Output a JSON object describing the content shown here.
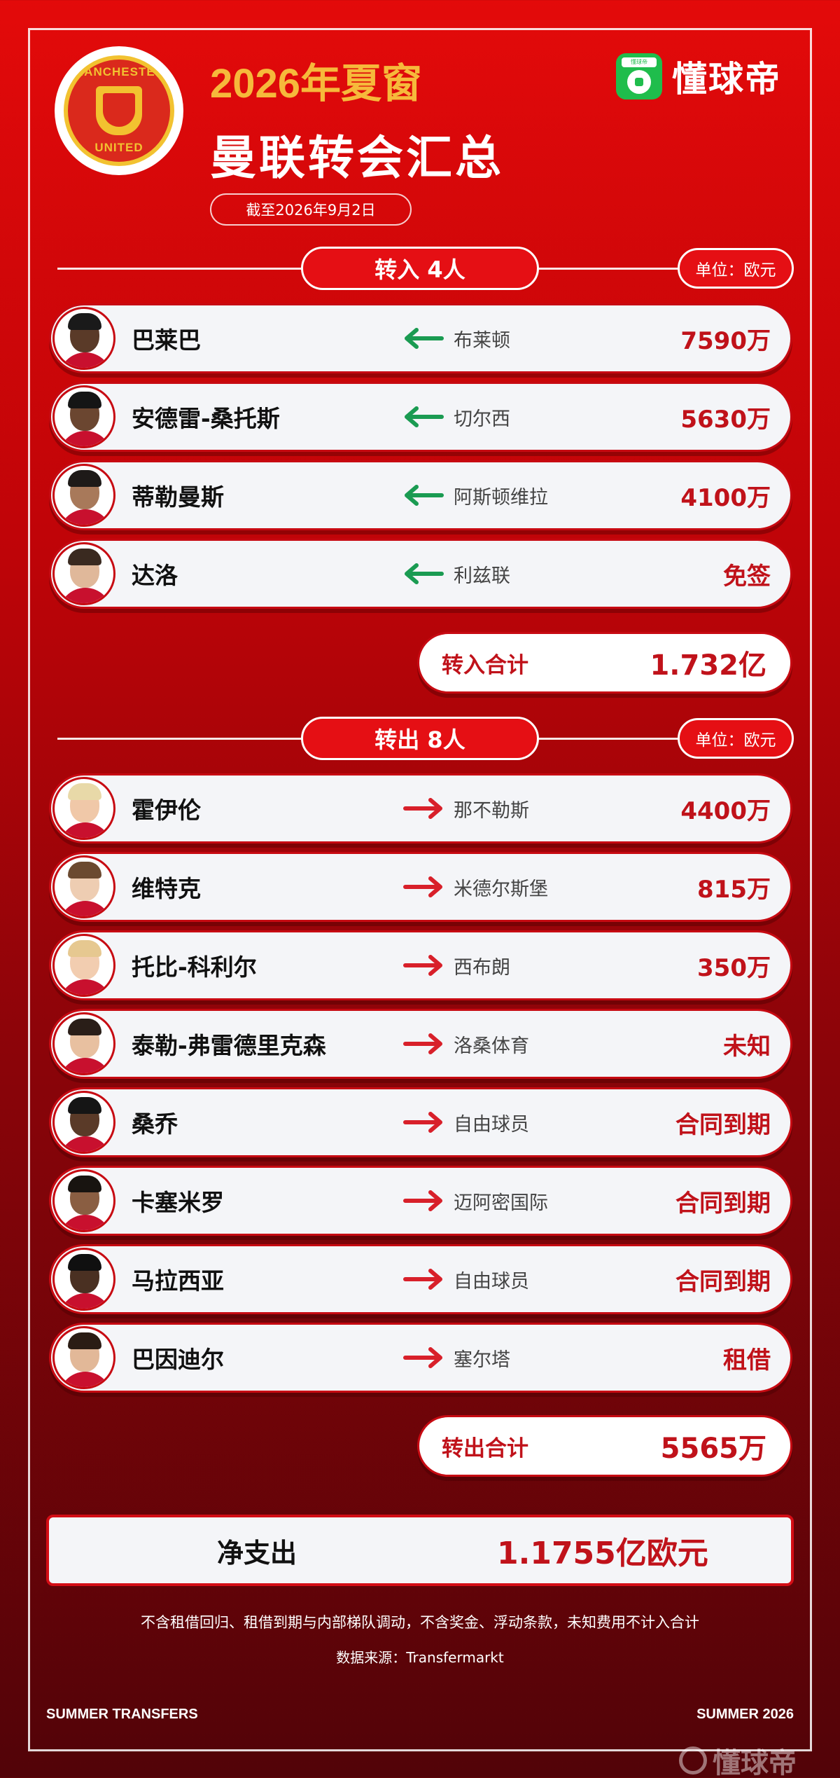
{
  "header": {
    "year_title": "2026年夏窗",
    "main_title": "曼联转会汇总",
    "date": "截至2026年9月2日",
    "brand_name": "懂球帝",
    "brand_icon_tag": "懂球帝",
    "crest_top": "MANCHESTER",
    "crest_bottom": "UNITED"
  },
  "incoming": {
    "title": "转入 4人",
    "unit": "单位：欧元",
    "players": [
      {
        "name": "巴莱巴",
        "club": "布莱顿",
        "fee": "7590万",
        "skin": "#5a3a28",
        "hair": "#1a1a1a"
      },
      {
        "name": "安德雷-桑托斯",
        "club": "切尔西",
        "fee": "5630万",
        "skin": "#6b4630",
        "hair": "#151515"
      },
      {
        "name": "蒂勒曼斯",
        "club": "阿斯顿维拉",
        "fee": "4100万",
        "skin": "#a8795a",
        "hair": "#1e1a18"
      },
      {
        "name": "达洛",
        "club": "利兹联",
        "fee": "免签",
        "skin": "#e0b89a",
        "hair": "#3a2a20"
      }
    ],
    "total_label": "转入合计",
    "total_value": "1.732亿"
  },
  "outgoing": {
    "title": "转出 8人",
    "unit": "单位：欧元",
    "players": [
      {
        "name": "霍伊伦",
        "club": "那不勒斯",
        "fee": "4400万",
        "skin": "#f0c8a8",
        "hair": "#e8d9a8"
      },
      {
        "name": "维特克",
        "club": "米德尔斯堡",
        "fee": "815万",
        "skin": "#eecdb2",
        "hair": "#6b4a30"
      },
      {
        "name": "托比-科利尔",
        "club": "西布朗",
        "fee": "350万",
        "skin": "#f2cdb0",
        "hair": "#e6c890"
      },
      {
        "name": "泰勒-弗雷德里克森",
        "club": "洛桑体育",
        "fee": "未知",
        "skin": "#e8c0a0",
        "hair": "#2a1e18"
      },
      {
        "name": "桑乔",
        "club": "自由球员",
        "fee": "合同到期",
        "skin": "#5a3a28",
        "hair": "#151515"
      },
      {
        "name": "卡塞米罗",
        "club": "迈阿密国际",
        "fee": "合同到期",
        "skin": "#8a5e42",
        "hair": "#181410"
      },
      {
        "name": "马拉西亚",
        "club": "自由球员",
        "fee": "合同到期",
        "skin": "#4a3022",
        "hair": "#101010"
      },
      {
        "name": "巴因迪尔",
        "club": "塞尔塔",
        "fee": "租借",
        "skin": "#e2b898",
        "hair": "#2a1c14"
      }
    ],
    "total_label": "转出合计",
    "total_value": "5565万"
  },
  "net": {
    "label": "净支出",
    "value": "1.1755亿欧元"
  },
  "footer": {
    "note": "不含租借回归、租借到期与内部梯队调动，不含奖金、浮动条款，未知费用不计入合计",
    "source": "数据来源：Transfermarkt",
    "left_corner": "SUMMER TRANSFERS",
    "right_corner": "SUMMER 2026",
    "watermark": "懂球帝"
  },
  "colors": {
    "in_arrow": "#1a9b52",
    "out_arrow": "#d8202a",
    "accent": "#c0121a",
    "title_gold": "#f6b93b"
  }
}
